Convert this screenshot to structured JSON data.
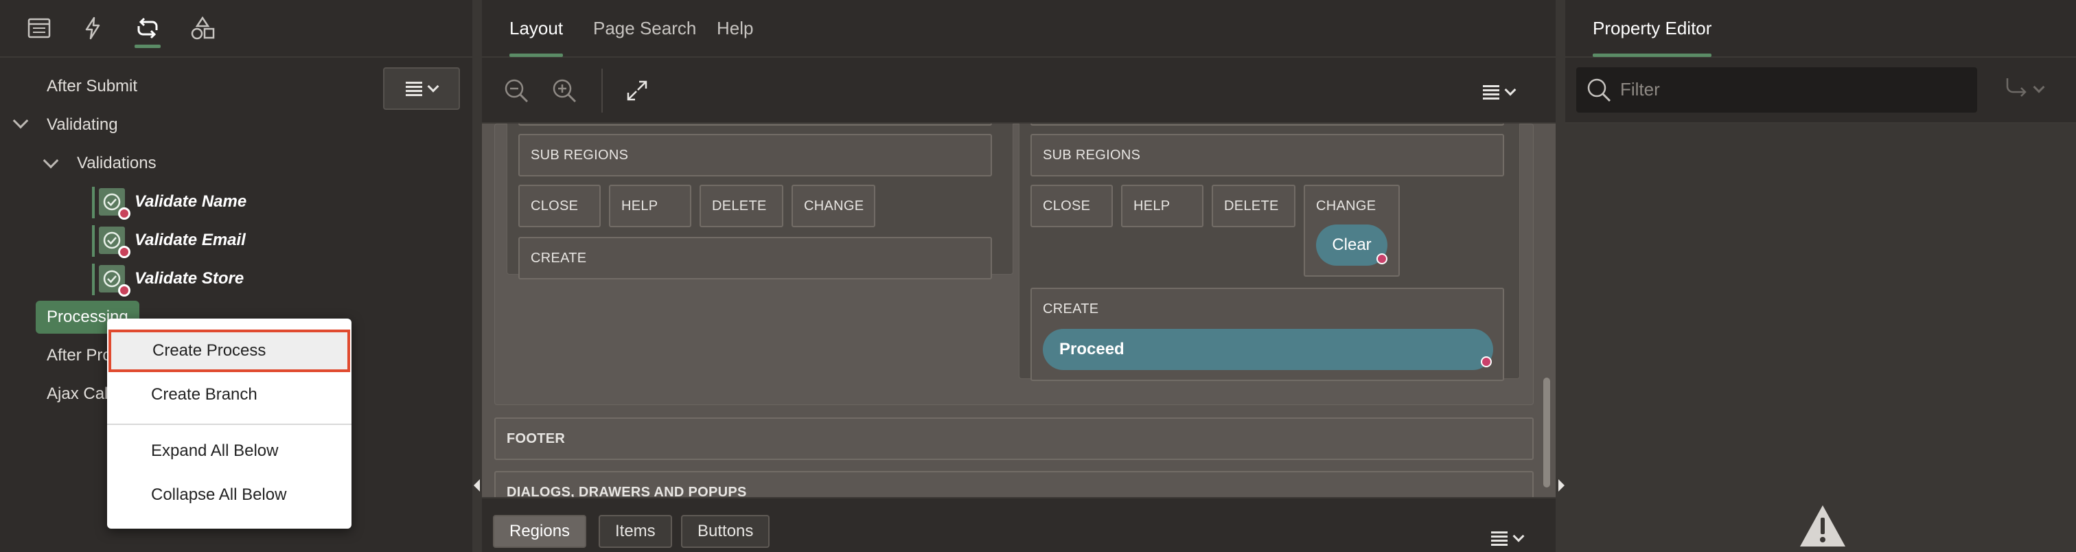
{
  "left_panel": {
    "tabs": [
      {
        "name": "rendering",
        "icon": "rendering-tree-icon"
      },
      {
        "name": "dynamic-actions",
        "icon": "lightning-icon"
      },
      {
        "name": "processing",
        "icon": "processing-cycle-icon",
        "active": true
      },
      {
        "name": "shared-components",
        "icon": "shapes-icon"
      }
    ],
    "tree": {
      "after_submit": "After Submit",
      "validating": "Validating",
      "validations": "Validations",
      "items": [
        {
          "label": "Validate Name"
        },
        {
          "label": "Validate Email"
        },
        {
          "label": "Validate Store"
        }
      ],
      "processing": "Processing",
      "after_processing": "After Pro",
      "ajax_callback": "Ajax Cal"
    },
    "context_menu": {
      "create_process": "Create Process",
      "create_branch": "Create Branch",
      "expand_all_below": "Expand All Below",
      "collapse_all_below": "Collapse All Below"
    }
  },
  "center_panel": {
    "tabs": [
      "Layout",
      "Page Search",
      "Help"
    ],
    "active_tab": "Layout",
    "left_region": {
      "sub_regions": "SUB REGIONS",
      "slots": [
        "CLOSE",
        "HELP",
        "DELETE",
        "CHANGE"
      ],
      "create": "CREATE"
    },
    "right_region": {
      "sub_regions": "SUB REGIONS",
      "slots": [
        "CLOSE",
        "HELP",
        "DELETE",
        "CHANGE"
      ],
      "clear_button": "Clear",
      "create": "CREATE",
      "proceed_button": "Proceed"
    },
    "footer": "FOOTER",
    "dialogs": "DIALOGS, DRAWERS AND POPUPS",
    "bottom_tabs": [
      "Regions",
      "Items",
      "Buttons"
    ],
    "active_bottom_tab": "Regions"
  },
  "right_panel": {
    "title": "Property Editor",
    "filter_placeholder": "Filter"
  },
  "colors": {
    "accent_green": "#5b8c66",
    "teal_button": "#4e7f8a",
    "highlight_red": "#e04a2f"
  }
}
